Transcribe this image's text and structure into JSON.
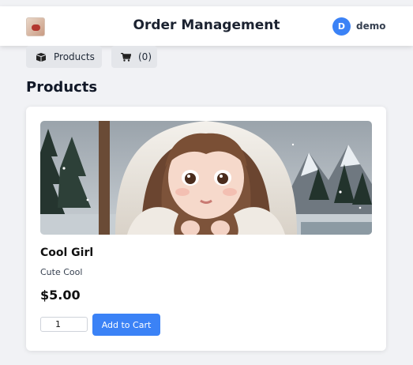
{
  "header": {
    "title": "Order Management",
    "logo_icon": "product-logo-icon",
    "user": {
      "initial": "D",
      "name": "demo",
      "avatar_color": "#3b82f6"
    }
  },
  "nav": {
    "products": {
      "label": "Products",
      "icon": "box-icon"
    },
    "cart": {
      "label": "(0)",
      "icon": "cart-icon"
    }
  },
  "section": {
    "title": "Products"
  },
  "product": {
    "image_icon": "product-image",
    "name": "Cool Girl",
    "description": "Cute Cool",
    "price": "$5.00",
    "quantity": "1",
    "add_to_cart_label": "Add to Cart"
  },
  "colors": {
    "accent": "#3b82f6",
    "page_bg": "#f1f2f5"
  }
}
